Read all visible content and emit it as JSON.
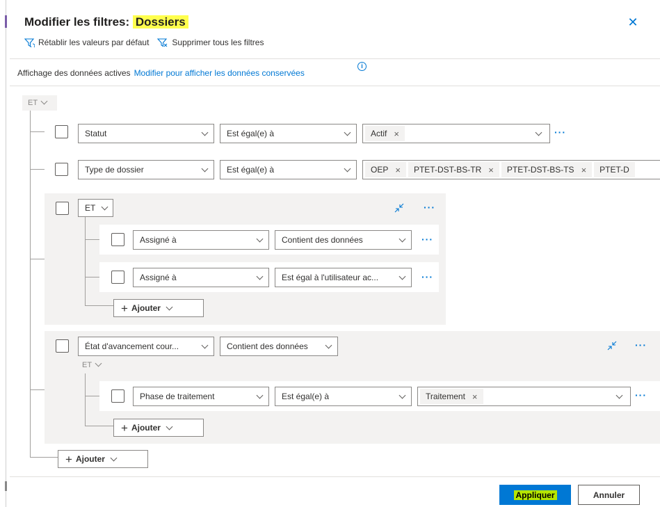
{
  "dialog": {
    "title_prefix": "Modifier les filtres: ",
    "title_entity": "Dossiers",
    "close_icon": "close-icon"
  },
  "toolbar": {
    "reset_label": "Rétablir les valeurs par défaut",
    "clear_label": "Supprimer tous les filtres"
  },
  "info": {
    "text": "Affichage des données actives",
    "link": "Modifier pour afficher les données conservées",
    "icon": "info-icon"
  },
  "root": {
    "operator": "ET",
    "rows": [
      {
        "field": "Statut",
        "condition": "Est égal(e) à",
        "values": [
          "Actif"
        ]
      },
      {
        "field": "Type de dossier",
        "condition": "Est égal(e) à",
        "values": [
          "OEP",
          "PTET-DST-BS-TR",
          "PTET-DST-BS-TS",
          "PTET-D"
        ]
      }
    ],
    "group1": {
      "operator": "ET",
      "rows": [
        {
          "field": "Assigné à",
          "condition": "Contient des données"
        },
        {
          "field": "Assigné à",
          "condition": "Est égal à l'utilisateur ac..."
        }
      ],
      "add_label": "Ajouter"
    },
    "group2": {
      "field": "État d'avancement cour...",
      "condition": "Contient des données",
      "operator": "ET",
      "row": {
        "field": "Phase de traitement",
        "condition": "Est égal(e) à",
        "values": [
          "Traitement"
        ]
      },
      "add_label": "Ajouter"
    },
    "add_label": "Ajouter"
  },
  "footer": {
    "apply_label": "Appliquer",
    "cancel_label": "Annuler"
  },
  "colors": {
    "accent": "#0078d4",
    "highlight_title": "#ffff4d",
    "highlight_apply": "#b6e600",
    "group_bg": "#f3f2f1"
  }
}
